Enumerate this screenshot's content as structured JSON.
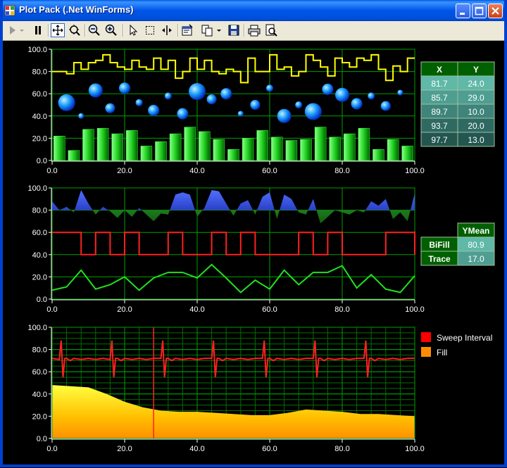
{
  "window": {
    "title": "Plot Pack (.Net WinForms)",
    "buttons": [
      "minimize-button",
      "maximize-button",
      "close-button"
    ]
  },
  "toolbar": {
    "items": [
      {
        "name": "play-icon",
        "interactable": true
      },
      {
        "name": "dropdown-arrow-icon",
        "interactable": true
      },
      {
        "name": "pause-icon",
        "interactable": true
      },
      {
        "name": "pan-icon",
        "interactable": true
      },
      {
        "name": "zoom-fit-icon",
        "interactable": true
      },
      {
        "name": "zoom-out-icon",
        "interactable": true
      },
      {
        "name": "zoom-in-icon",
        "interactable": true
      },
      {
        "name": "pointer-icon",
        "interactable": true
      },
      {
        "name": "select-box-icon",
        "interactable": true
      },
      {
        "name": "cursor-icon",
        "interactable": true
      },
      {
        "name": "properties-icon",
        "interactable": true
      },
      {
        "name": "copy-icon",
        "interactable": true
      },
      {
        "name": "save-icon",
        "interactable": true
      },
      {
        "name": "print-icon",
        "interactable": true
      },
      {
        "name": "print-preview-icon",
        "interactable": true
      }
    ]
  },
  "colors": {
    "grid": "#00a000",
    "axis": "#ffffff",
    "yellow": "#ffff00",
    "red": "#ff2020",
    "green": "#20e020",
    "blue": "#3050ff",
    "orange": "#ff8c00"
  },
  "chart_data": [
    {
      "type": "bar",
      "title": "",
      "xlim": [
        0,
        100
      ],
      "ylim": [
        0,
        100
      ],
      "xticks": [
        "0.0",
        "20.0",
        "40.0",
        "60.0",
        "80.0",
        "100.0"
      ],
      "yticks": [
        "0.0",
        "20.0",
        "40.0",
        "60.0",
        "80.0",
        "100.0"
      ],
      "series": [
        {
          "kind": "bar",
          "x": [
            2,
            6,
            10,
            14,
            18,
            22,
            26,
            30,
            34,
            38,
            42,
            46,
            50,
            54,
            58,
            62,
            66,
            70,
            74,
            78,
            82,
            86,
            90,
            94,
            98
          ],
          "values": [
            22,
            9,
            28,
            29,
            24,
            27,
            13,
            17,
            24,
            30,
            26,
            19,
            10,
            20,
            27,
            21,
            18,
            19,
            30,
            21,
            24,
            29,
            10,
            19,
            13
          ]
        },
        {
          "kind": "step",
          "x": [
            0,
            2,
            4,
            6,
            8,
            10,
            12,
            14,
            16,
            18,
            20,
            22,
            24,
            26,
            28,
            30,
            32,
            34,
            36,
            38,
            40,
            42,
            44,
            46,
            48,
            50,
            52,
            54,
            56,
            58,
            60,
            62,
            64,
            66,
            68,
            70,
            72,
            74,
            76,
            78,
            80,
            82,
            84,
            86,
            88,
            90,
            92,
            94,
            96,
            98,
            100
          ],
          "values": [
            80,
            80,
            78,
            88,
            82,
            88,
            90,
            95,
            88,
            84,
            82,
            90,
            84,
            82,
            92,
            82,
            90,
            74,
            80,
            92,
            82,
            90,
            80,
            78,
            82,
            80,
            70,
            92,
            80,
            80,
            95,
            82,
            84,
            76,
            80,
            95,
            90,
            84,
            76,
            92,
            88,
            84,
            92,
            90,
            95,
            82,
            72,
            85,
            80,
            92,
            92
          ]
        },
        {
          "kind": "bubble",
          "points": [
            {
              "x": 4,
              "y": 52,
              "r": 12
            },
            {
              "x": 8,
              "y": 40,
              "r": 4
            },
            {
              "x": 12,
              "y": 63,
              "r": 10
            },
            {
              "x": 16,
              "y": 47,
              "r": 7
            },
            {
              "x": 20,
              "y": 65,
              "r": 8
            },
            {
              "x": 24,
              "y": 52,
              "r": 5
            },
            {
              "x": 28,
              "y": 45,
              "r": 8
            },
            {
              "x": 32,
              "y": 58,
              "r": 5
            },
            {
              "x": 36,
              "y": 42,
              "r": 8
            },
            {
              "x": 40,
              "y": 62,
              "r": 12
            },
            {
              "x": 44,
              "y": 55,
              "r": 7
            },
            {
              "x": 48,
              "y": 60,
              "r": 8
            },
            {
              "x": 52,
              "y": 42,
              "r": 4
            },
            {
              "x": 56,
              "y": 50,
              "r": 7
            },
            {
              "x": 60,
              "y": 65,
              "r": 5
            },
            {
              "x": 64,
              "y": 40,
              "r": 10
            },
            {
              "x": 68,
              "y": 50,
              "r": 5
            },
            {
              "x": 72,
              "y": 44,
              "r": 12
            },
            {
              "x": 76,
              "y": 64,
              "r": 8
            },
            {
              "x": 80,
              "y": 59,
              "r": 10
            },
            {
              "x": 84,
              "y": 51,
              "r": 8
            },
            {
              "x": 88,
              "y": 58,
              "r": 5
            },
            {
              "x": 92,
              "y": 49,
              "r": 7
            },
            {
              "x": 96,
              "y": 61,
              "r": 4
            }
          ]
        }
      ],
      "table": {
        "headers": [
          "X",
          "Y"
        ],
        "rows": [
          [
            "81.7",
            "24.0"
          ],
          [
            "85.7",
            "29.0"
          ],
          [
            "89.7",
            "10.0"
          ],
          [
            "93.7",
            "20.0"
          ],
          [
            "97.7",
            "13.0"
          ]
        ]
      }
    },
    {
      "type": "line",
      "xlim": [
        0,
        100
      ],
      "ylim": [
        0,
        100
      ],
      "xticks": [
        "0.0",
        "20.0",
        "40.0",
        "60.0",
        "80.0",
        "100.0"
      ],
      "yticks": [
        "0.0",
        "20.0",
        "40.0",
        "60.0",
        "80.0",
        "100.0"
      ],
      "series": [
        {
          "name": "BiFill",
          "kind": "bifill",
          "baseline": 80,
          "x": [
            0,
            2,
            4,
            6,
            8,
            10,
            12,
            14,
            16,
            18,
            20,
            22,
            24,
            26,
            28,
            30,
            32,
            34,
            36,
            38,
            40,
            42,
            44,
            46,
            48,
            50,
            52,
            54,
            56,
            58,
            60,
            62,
            64,
            66,
            68,
            70,
            72,
            74,
            76,
            78,
            80,
            82,
            84,
            86,
            88,
            90,
            92,
            94,
            96,
            98,
            100
          ],
          "values": [
            88,
            80,
            83,
            78,
            98,
            86,
            76,
            83,
            79,
            73,
            80,
            74,
            82,
            76,
            70,
            77,
            76,
            94,
            96,
            94,
            74,
            82,
            98,
            97,
            86,
            75,
            86,
            89,
            76,
            92,
            96,
            72,
            94,
            90,
            78,
            76,
            90,
            68,
            74,
            80,
            78,
            76,
            80,
            78,
            88,
            84,
            90,
            72,
            78,
            70,
            95
          ]
        },
        {
          "name": "",
          "kind": "step",
          "x": [
            0,
            4,
            8,
            12,
            16,
            20,
            24,
            28,
            32,
            36,
            40,
            44,
            48,
            52,
            56,
            60,
            64,
            68,
            72,
            76,
            80,
            84,
            88,
            92,
            96,
            100
          ],
          "values": [
            60,
            60,
            40,
            60,
            40,
            60,
            40,
            40,
            60,
            40,
            40,
            60,
            40,
            60,
            40,
            40,
            40,
            60,
            40,
            60,
            40,
            40,
            40,
            60,
            60,
            40
          ]
        },
        {
          "name": "Trace",
          "kind": "line",
          "x": [
            0,
            4,
            8,
            12,
            16,
            20,
            24,
            28,
            32,
            36,
            40,
            44,
            48,
            52,
            56,
            60,
            64,
            68,
            72,
            76,
            80,
            84,
            88,
            92,
            96,
            100
          ],
          "values": [
            8,
            11,
            26,
            9,
            13,
            20,
            8,
            19,
            24,
            24,
            19,
            31,
            19,
            6,
            17,
            9,
            26,
            13,
            24,
            24,
            30,
            10,
            22,
            9,
            6,
            21
          ]
        }
      ],
      "table": {
        "headers": [
          "",
          "YMean"
        ],
        "rows": [
          [
            "BiFill",
            "80.9"
          ],
          [
            "Trace",
            "17.0"
          ]
        ]
      }
    },
    {
      "type": "area",
      "xlim": [
        0,
        100
      ],
      "ylim": [
        0,
        100
      ],
      "xticks": [
        "0.0",
        "20.0",
        "40.0",
        "60.0",
        "80.0",
        "100.0"
      ],
      "yticks": [
        "0.0",
        "20.0",
        "40.0",
        "60.0",
        "80.0",
        "100.0"
      ],
      "cursor_x": 28,
      "series": [
        {
          "name": "Sweep Interval",
          "kind": "line",
          "x": [
            0,
            2,
            2.5,
            3,
            3.5,
            4,
            5,
            6,
            8,
            10,
            12,
            14,
            16,
            16.5,
            17,
            17.5,
            18,
            19,
            20,
            22,
            24,
            26,
            28,
            30,
            30.5,
            31,
            31.5,
            32,
            33,
            34,
            36,
            38,
            40,
            42,
            44,
            44.5,
            45,
            45.5,
            46,
            47,
            48,
            50,
            52,
            54,
            56,
            58,
            58.5,
            59,
            59.5,
            60,
            61,
            62,
            64,
            66,
            68,
            70,
            72,
            72.5,
            73,
            73.5,
            74,
            75,
            76,
            78,
            80,
            82,
            84,
            86,
            86.5,
            87,
            87.5,
            88,
            89,
            90,
            92,
            94,
            96,
            98,
            100
          ],
          "values": [
            72,
            71,
            88,
            55,
            72,
            72,
            70,
            72,
            71,
            72,
            71,
            72,
            71,
            88,
            55,
            72,
            72,
            70,
            72,
            71,
            72,
            71,
            72,
            72,
            88,
            55,
            72,
            72,
            70,
            72,
            71,
            72,
            71,
            72,
            72,
            88,
            55,
            72,
            72,
            70,
            72,
            71,
            72,
            71,
            72,
            72,
            88,
            55,
            72,
            72,
            70,
            72,
            71,
            72,
            71,
            72,
            72,
            88,
            55,
            72,
            72,
            70,
            72,
            71,
            72,
            71,
            72,
            72,
            88,
            55,
            72,
            72,
            70,
            72,
            71,
            72,
            71,
            72,
            72
          ]
        },
        {
          "name": "Fill",
          "kind": "area",
          "x": [
            0,
            5,
            10,
            15,
            20,
            25,
            30,
            35,
            40,
            45,
            50,
            55,
            60,
            65,
            70,
            75,
            80,
            85,
            90,
            95,
            100
          ],
          "values": [
            48,
            47,
            46,
            40,
            33,
            28,
            25,
            24,
            24,
            23,
            22,
            21,
            21,
            23,
            26,
            25,
            24,
            22,
            22,
            21,
            20
          ]
        }
      ],
      "legend": [
        {
          "label": "Sweep Interval",
          "color": "#ff0000"
        },
        {
          "label": "Fill",
          "color": "#ff8c00"
        }
      ]
    }
  ]
}
